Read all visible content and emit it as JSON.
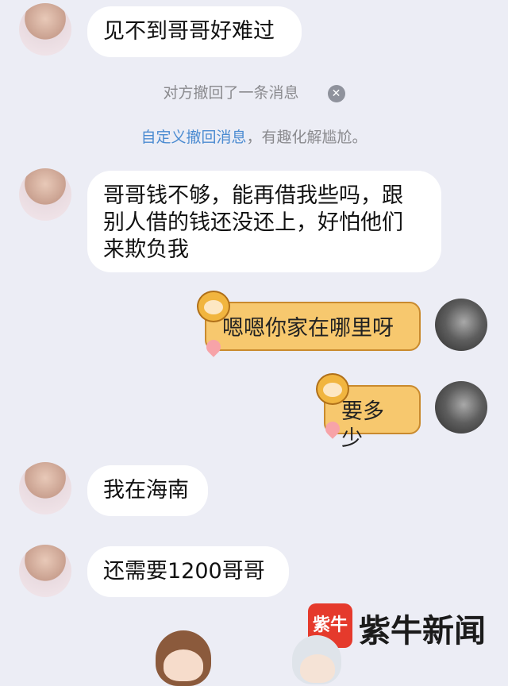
{
  "messages": [
    {
      "side": "in",
      "text": "见不到哥哥好难过"
    },
    {
      "side": "in",
      "text": "哥哥钱不够，能再借我些吗，跟\n别人借的钱还没还上，好怕他们\n来欺负我"
    },
    {
      "side": "out",
      "text": "嗯嗯你家在哪里呀"
    },
    {
      "side": "out",
      "text": "要多少"
    },
    {
      "side": "in",
      "text": "我在海南"
    },
    {
      "side": "in",
      "text": "还需要1200哥哥"
    }
  ],
  "system": {
    "recalled": "对方撤回了一条消息",
    "close_glyph": "✕",
    "hint_link": "自定义撤回消息",
    "hint_rest": "，有趣化解尴尬。"
  },
  "watermark": {
    "seal": "紫牛",
    "text": "紫牛新闻"
  },
  "colors": {
    "background": "#ECEDF5",
    "bubble_in": "#FFFFFF",
    "bubble_out": "#F7C86E",
    "bubble_out_border": "#C98A2E",
    "link": "#4B8BD1",
    "system_text": "#8A8A8E",
    "watermark_red": "#E53A2C"
  },
  "icons": [
    "contact-avatar",
    "self-avatar",
    "monkey-sticker-icon",
    "peach-icon",
    "close-circle-icon"
  ]
}
